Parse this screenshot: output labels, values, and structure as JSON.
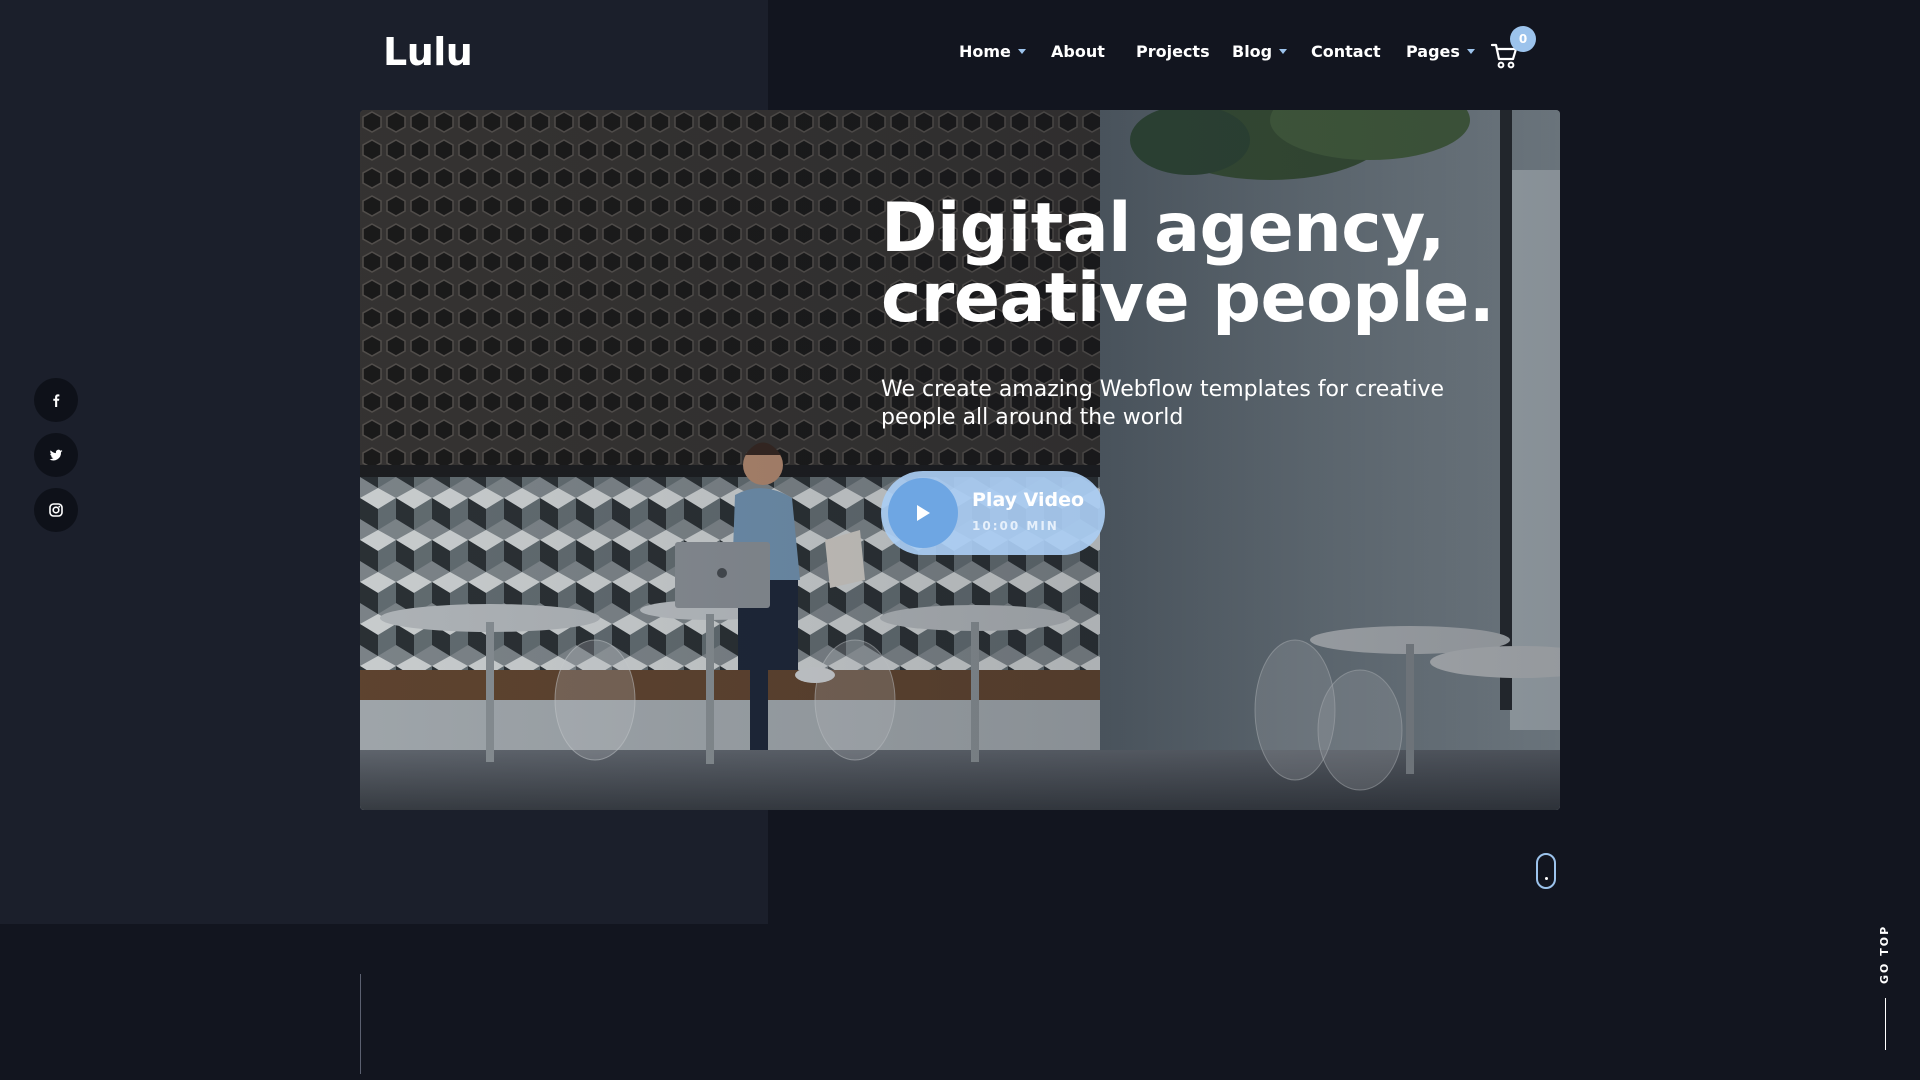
{
  "header": {
    "logo": "Lulu",
    "nav": [
      {
        "label": "Home",
        "has_dropdown": true
      },
      {
        "label": "About",
        "has_dropdown": false
      },
      {
        "label": "Projects",
        "has_dropdown": false
      },
      {
        "label": "Blog",
        "has_dropdown": true
      },
      {
        "label": "Contact",
        "has_dropdown": false
      },
      {
        "label": "Pages",
        "has_dropdown": true
      }
    ],
    "cart": {
      "icon": "cart-icon",
      "count": "0"
    }
  },
  "hero": {
    "title_line1": "Digital agency,",
    "title_line2": "creative people.",
    "subtitle": "We create amazing Webflow templates for creative people all around the world",
    "play_button": {
      "label": "Play Video",
      "duration": "10:00 MIN",
      "icon": "play-icon"
    }
  },
  "social": [
    {
      "name": "facebook",
      "icon": "facebook-icon"
    },
    {
      "name": "twitter",
      "icon": "twitter-icon"
    },
    {
      "name": "instagram",
      "icon": "instagram-icon"
    }
  ],
  "scroll_indicator": {
    "icon": "mouse-scroll-icon"
  },
  "go_top": {
    "label": "GO TOP"
  },
  "colors": {
    "background": "#12151f",
    "panel": "#1b1f2b",
    "accent": "#9cc3ec",
    "play_circle": "#6ea6e3",
    "text": "#ffffff"
  }
}
